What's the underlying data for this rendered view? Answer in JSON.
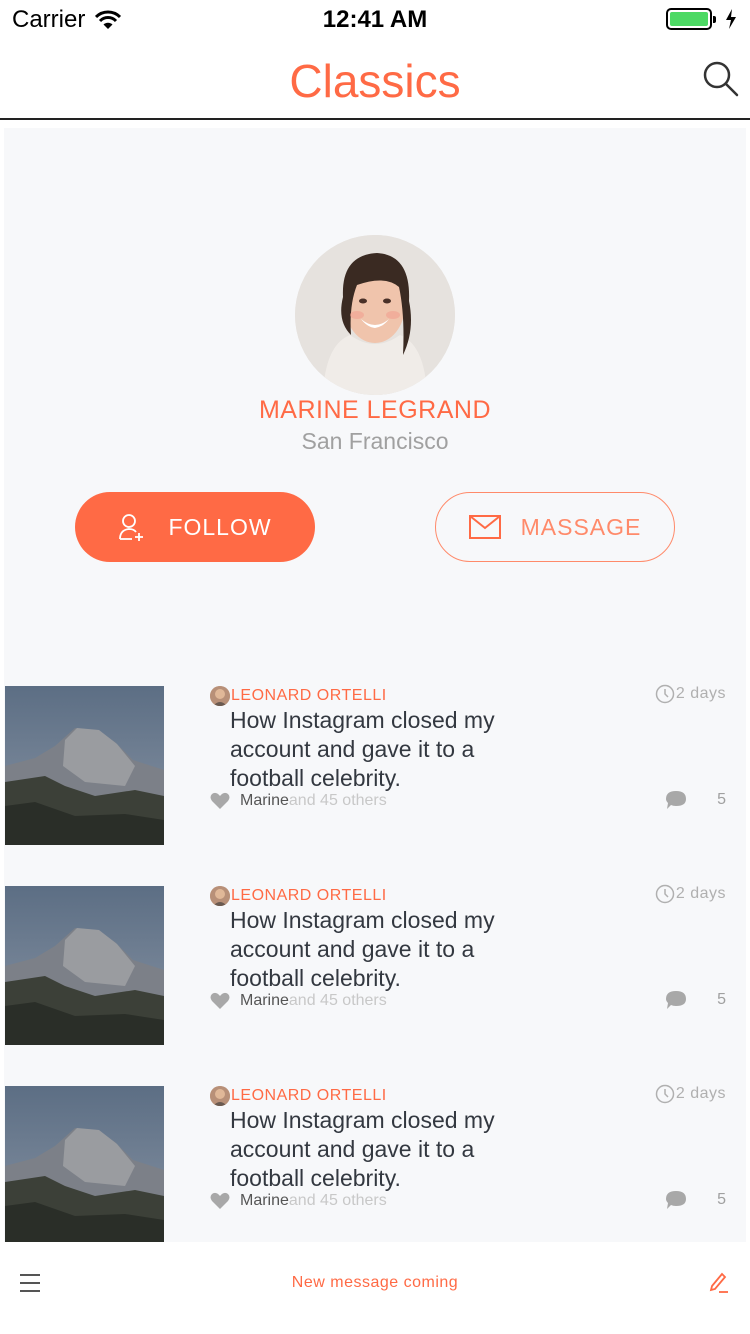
{
  "status_bar": {
    "carrier": "Carrier",
    "time": "12:41 AM",
    "icons": [
      "wifi-icon",
      "battery-icon",
      "charging-icon"
    ]
  },
  "header": {
    "title": "Classics",
    "search_icon": "search-icon"
  },
  "profile": {
    "name": "MARINE LEGRAND",
    "location": "San Francisco",
    "follow_label": "FOLLOW",
    "message_label": "MASSAGE"
  },
  "feed": [
    {
      "author": "LEONARD ORTELLI",
      "time": "2 days",
      "title": "How Instagram closed my account and gave it to a football celebrity.",
      "liker": "Marine",
      "likes_others": "and 45 others",
      "comments": "5"
    },
    {
      "author": "LEONARD ORTELLI",
      "time": "2 days",
      "title": "How Instagram closed my account and gave it to a football celebrity.",
      "liker": "Marine",
      "likes_others": "and 45 others",
      "comments": "5"
    },
    {
      "author": "LEONARD ORTELLI",
      "time": "2 days",
      "title": "How Instagram closed my account and gave it to a football celebrity.",
      "liker": "Marine",
      "likes_others": "and 45 others",
      "comments": "5"
    }
  ],
  "bottom_bar": {
    "text": "New message coming",
    "menu_icon": "menu-icon",
    "compose_icon": "compose-icon"
  },
  "colors": {
    "accent": "#ff6a45",
    "background": "#f7f8fa",
    "text": "#333840",
    "muted": "#a0a0a0",
    "battery": "#4cd964"
  }
}
